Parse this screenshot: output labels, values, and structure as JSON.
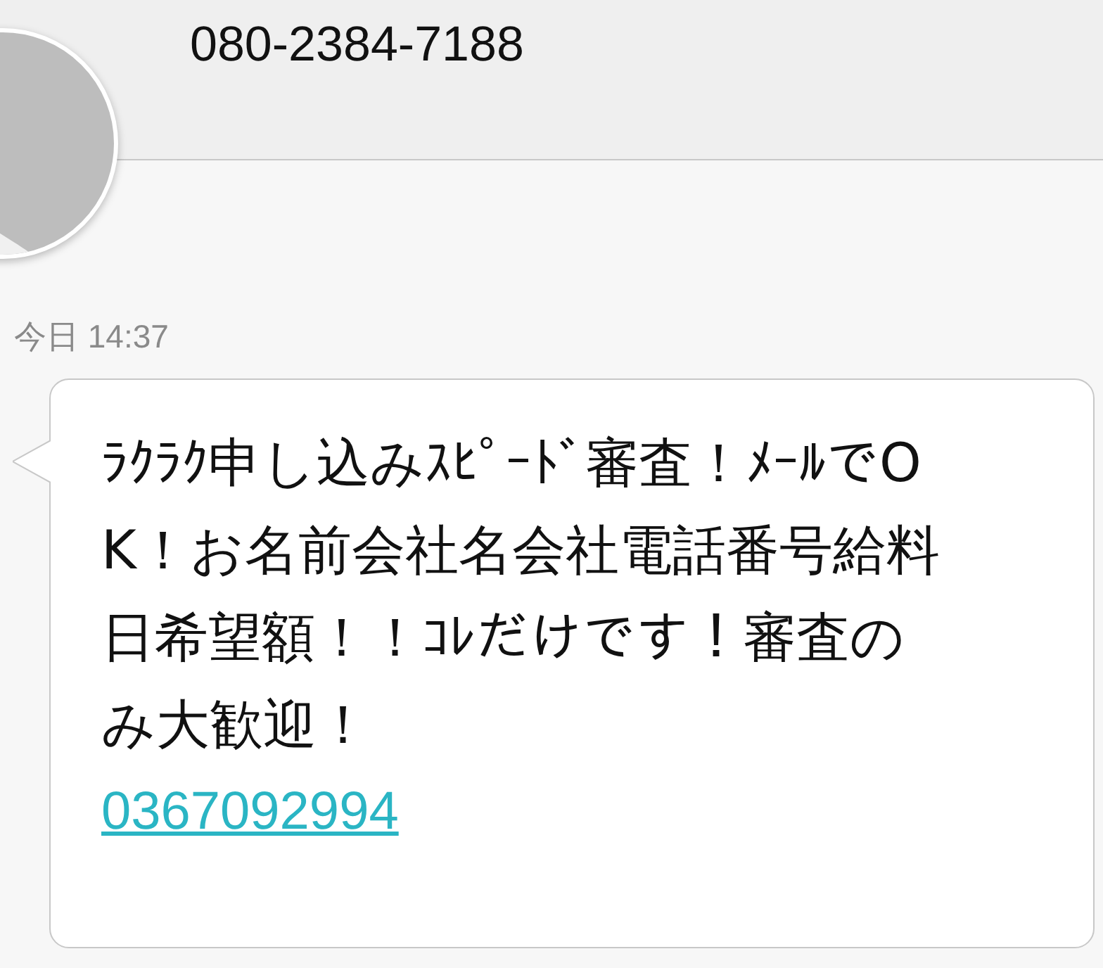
{
  "header": {
    "contact": "080-2384-7188"
  },
  "messages": [
    {
      "time": "今日 14:37",
      "text": "ﾗｸﾗｸ申し込みｽﾋﾟｰﾄﾞ審査！ﾒｰﾙでOK！お名前会社名会社電話番号給料日希望額！！ｺﾚだけです！審査のみ大歓迎！",
      "link": "0367092994"
    }
  ]
}
